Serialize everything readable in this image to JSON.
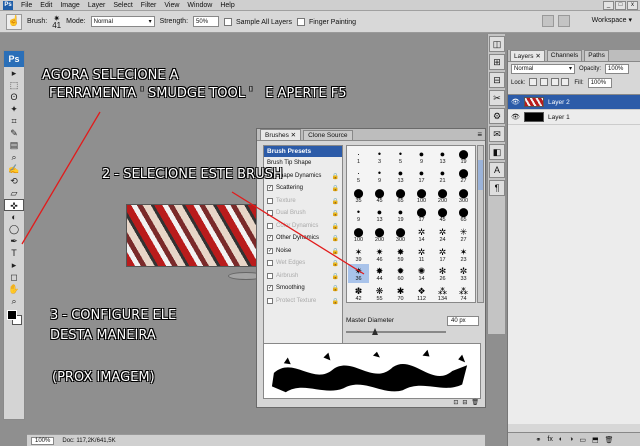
{
  "menubar": {
    "ps_badge": "Ps",
    "items": [
      "File",
      "Edit",
      "Image",
      "Layer",
      "Select",
      "Filter",
      "View",
      "Window",
      "Help"
    ],
    "win_controls": [
      "_",
      "□",
      "x"
    ]
  },
  "options": {
    "brush_label": "Brush:",
    "brush_size": "41",
    "mode_label": "Mode:",
    "mode_value": "Normal",
    "strength_label": "Strength:",
    "strength_value": "50%",
    "sample_all_layers": "Sample All Layers",
    "finger_painting": "Finger Painting",
    "workspace": "Workspace ▾"
  },
  "toolbox": {
    "logo": "Ps",
    "tools": [
      "▸",
      "⬚",
      "ʘ",
      "✦",
      "⌗",
      "✎",
      "▤",
      "⌕",
      "✍",
      "⟲",
      "▱",
      "✜",
      "◐",
      "◯",
      "✒",
      "T",
      "▸",
      "◻",
      "✋",
      "⌕"
    ]
  },
  "status": {
    "zoom": "100%",
    "doc": "Doc: 117,2K/641,5K"
  },
  "annotations": {
    "a1": "AGORA SELECIONE A",
    "a1b": "FERRAMENTA ' SMUDGE TOOL '   E APERTE F5",
    "a2": "2 - SELECIONE ESTE BRUSH",
    "a3": "3 - CONFIGURE ELE",
    "a3b": "DESTA MANEIRA",
    "a4": "(PROX IMAGEM)"
  },
  "brushes_panel": {
    "tabs": [
      "Brushes ✕",
      "Clone Source"
    ],
    "presets_header": "Brush Presets",
    "options": [
      {
        "label": "Brush Tip Shape",
        "checked": null,
        "dim": false
      },
      {
        "label": "Shape Dynamics",
        "checked": true,
        "dim": false
      },
      {
        "label": "Scattering",
        "checked": true,
        "dim": false
      },
      {
        "label": "Texture",
        "checked": false,
        "dim": true
      },
      {
        "label": "Dual Brush",
        "checked": false,
        "dim": true
      },
      {
        "label": "Color Dynamics",
        "checked": false,
        "dim": true
      },
      {
        "label": "Other Dynamics",
        "checked": true,
        "dim": false
      },
      {
        "label": "Noise",
        "checked": true,
        "dim": false
      },
      {
        "label": "Wet Edges",
        "checked": false,
        "dim": true
      },
      {
        "label": "Airbrush",
        "checked": false,
        "dim": true
      },
      {
        "label": "Smoothing",
        "checked": true,
        "dim": false
      },
      {
        "label": "Protect Texture",
        "checked": false,
        "dim": true
      }
    ],
    "grid": [
      {
        "g": "·",
        "n": "1"
      },
      {
        "g": "•",
        "n": "3"
      },
      {
        "g": "•",
        "n": "5"
      },
      {
        "g": "●",
        "n": "9"
      },
      {
        "g": "●",
        "n": "13"
      },
      {
        "g": "⬤",
        "n": "19"
      },
      {
        "g": "·",
        "n": "5"
      },
      {
        "g": "•",
        "n": "9"
      },
      {
        "g": "●",
        "n": "13"
      },
      {
        "g": "●",
        "n": "17"
      },
      {
        "g": "●",
        "n": "21"
      },
      {
        "g": "⬤",
        "n": "27"
      },
      {
        "g": "⬤",
        "n": "35"
      },
      {
        "g": "⬤",
        "n": "45"
      },
      {
        "g": "⬤",
        "n": "65"
      },
      {
        "g": "⬤",
        "n": "100"
      },
      {
        "g": "⬤",
        "n": "200"
      },
      {
        "g": "⬤",
        "n": "300"
      },
      {
        "g": "•",
        "n": "9"
      },
      {
        "g": "●",
        "n": "13"
      },
      {
        "g": "●",
        "n": "19"
      },
      {
        "g": "⬤",
        "n": "17"
      },
      {
        "g": "⬤",
        "n": "45"
      },
      {
        "g": "⬤",
        "n": "65"
      },
      {
        "g": "⬤",
        "n": "100"
      },
      {
        "g": "⬤",
        "n": "200"
      },
      {
        "g": "⬤",
        "n": "300"
      },
      {
        "g": "✲",
        "n": "14"
      },
      {
        "g": "✲",
        "n": "24"
      },
      {
        "g": "✳",
        "n": "27"
      },
      {
        "g": "✶",
        "n": "39"
      },
      {
        "g": "✷",
        "n": "46"
      },
      {
        "g": "✸",
        "n": "59"
      },
      {
        "g": "✲",
        "n": "11"
      },
      {
        "g": "✲",
        "n": "17"
      },
      {
        "g": "✶",
        "n": "23"
      },
      {
        "g": "✷",
        "n": "36"
      },
      {
        "g": "✸",
        "n": "44"
      },
      {
        "g": "✹",
        "n": "60"
      },
      {
        "g": "✺",
        "n": "14"
      },
      {
        "g": "✻",
        "n": "26"
      },
      {
        "g": "✼",
        "n": "33"
      },
      {
        "g": "✽",
        "n": "42"
      },
      {
        "g": "❋",
        "n": "55"
      },
      {
        "g": "✱",
        "n": "70"
      },
      {
        "g": "❖",
        "n": "112"
      },
      {
        "g": "⁂",
        "n": "134"
      },
      {
        "g": "⁂",
        "n": "74"
      },
      {
        "g": "⁂",
        "n": "95"
      },
      {
        "g": "⁂",
        "n": "95"
      },
      {
        "g": "⁂",
        "n": "90"
      },
      {
        "g": "⁂",
        "n": "36"
      },
      {
        "g": "⁂",
        "n": "36"
      },
      {
        "g": "⁂",
        "n": "33"
      }
    ],
    "selected_index": 36,
    "master_label": "Master Diameter",
    "master_value": "40 px",
    "footer": [
      "⊡",
      "⊟",
      "🗑"
    ]
  },
  "dock": {
    "icons": [
      "◫",
      "⊞",
      "⊟",
      "✂",
      "⚙",
      "✉",
      "◧",
      "A",
      "¶"
    ]
  },
  "layers_panel": {
    "tabs": [
      "Layers ✕",
      "Channels",
      "Paths"
    ],
    "blend_mode": "Normal",
    "opacity_label": "Opacity:",
    "opacity_value": "100%",
    "lock_label": "Lock:",
    "fill_label": "Fill:",
    "fill_value": "100%",
    "layers": [
      {
        "name": "Layer 2",
        "selected": true,
        "thumb": "t2"
      },
      {
        "name": "Layer 1",
        "selected": false,
        "thumb": "t1"
      }
    ],
    "footer_icons": [
      "⚭",
      "fx",
      "◐",
      "◑",
      "▭",
      "⬒",
      "🗑"
    ]
  }
}
